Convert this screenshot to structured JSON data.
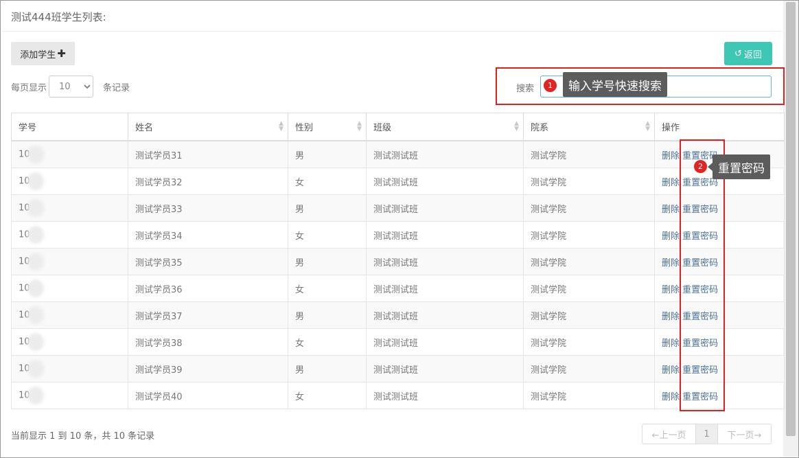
{
  "page": {
    "title": "测试444班学生列表:"
  },
  "toolbar": {
    "add_label": "添加学生",
    "add_icon": "plus-icon",
    "back_label": "返回",
    "back_icon": "undo-icon",
    "back_color": "#3ec7b5"
  },
  "page_size": {
    "prefix": "每页显示",
    "value": "10",
    "suffix": "条记录"
  },
  "search": {
    "label": "搜索",
    "value": ""
  },
  "annotations": {
    "badge1": "1",
    "tooltip1": "输入学号快速搜索",
    "badge2": "2",
    "tooltip2": "重置密码",
    "highlight_color": "#e02020"
  },
  "table": {
    "headers": [
      "学号",
      "姓名",
      "性别",
      "班级",
      "院系",
      "操作"
    ],
    "rows": [
      {
        "id": "10",
        "name": "测试学员31",
        "gender": "男",
        "class": "测试测试班",
        "dept": "测试学院",
        "del": "删除",
        "reset": "重置密码"
      },
      {
        "id": "10",
        "name": "测试学员32",
        "gender": "女",
        "class": "测试测试班",
        "dept": "测试学院",
        "del": "删除",
        "reset": "重置密码"
      },
      {
        "id": "10",
        "name": "测试学员33",
        "gender": "男",
        "class": "测试测试班",
        "dept": "测试学院",
        "del": "删除",
        "reset": "重置密码"
      },
      {
        "id": "10",
        "name": "测试学员34",
        "gender": "女",
        "class": "测试测试班",
        "dept": "测试学院",
        "del": "删除",
        "reset": "重置密码"
      },
      {
        "id": "10",
        "name": "测试学员35",
        "gender": "男",
        "class": "测试测试班",
        "dept": "测试学院",
        "del": "删除",
        "reset": "重置密码"
      },
      {
        "id": "10",
        "name": "测试学员36",
        "gender": "女",
        "class": "测试测试班",
        "dept": "测试学院",
        "del": "删除",
        "reset": "重置密码"
      },
      {
        "id": "10",
        "name": "测试学员37",
        "gender": "男",
        "class": "测试测试班",
        "dept": "测试学院",
        "del": "删除",
        "reset": "重置密码"
      },
      {
        "id": "10",
        "name": "测试学员38",
        "gender": "女",
        "class": "测试测试班",
        "dept": "测试学院",
        "del": "删除",
        "reset": "重置密码"
      },
      {
        "id": "10",
        "name": "测试学员39",
        "gender": "男",
        "class": "测试测试班",
        "dept": "测试学院",
        "del": "删除",
        "reset": "重置密码"
      },
      {
        "id": "10",
        "name": "测试学员40",
        "gender": "女",
        "class": "测试测试班",
        "dept": "测试学院",
        "del": "删除",
        "reset": "重置密码"
      }
    ]
  },
  "footer": {
    "info": "当前显示 1 到 10 条，共 10 条记录"
  },
  "pagination": {
    "prev": "←上一页",
    "current": "1",
    "next": "下一页→"
  }
}
